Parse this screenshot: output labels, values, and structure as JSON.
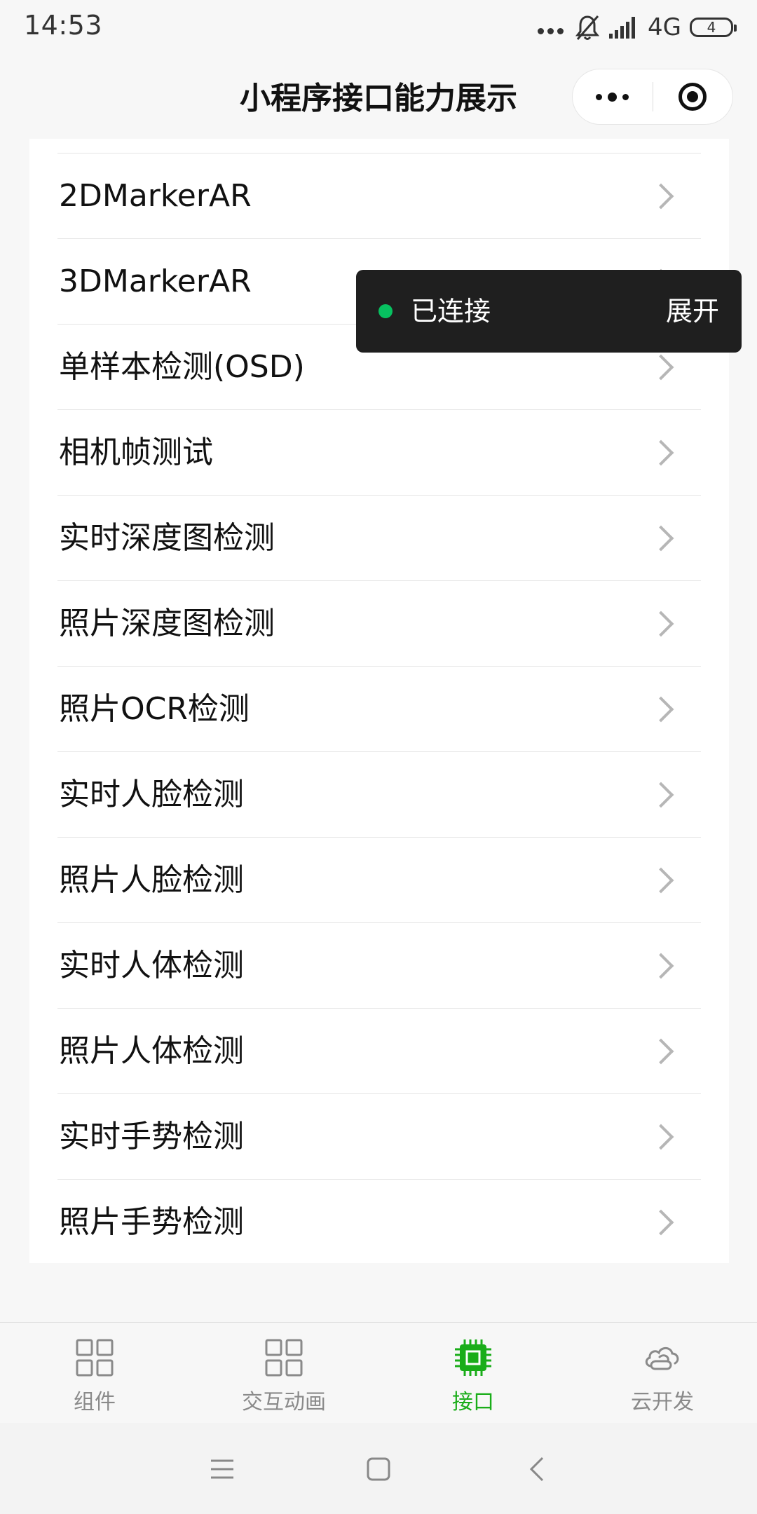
{
  "status_bar": {
    "time": "14:53",
    "network": "4G",
    "battery": "4"
  },
  "header": {
    "title": "小程序接口能力展示"
  },
  "list": {
    "items": [
      {
        "label": "2DMarkerAR"
      },
      {
        "label": "3DMarkerAR"
      },
      {
        "label": "单样本检测(OSD)"
      },
      {
        "label": "相机帧测试"
      },
      {
        "label": "实时深度图检测"
      },
      {
        "label": "照片深度图检测"
      },
      {
        "label": "照片OCR检测"
      },
      {
        "label": "实时人脸检测"
      },
      {
        "label": "照片人脸检测"
      },
      {
        "label": "实时人体检测"
      },
      {
        "label": "照片人体检测"
      },
      {
        "label": "实时手势检测"
      },
      {
        "label": "照片手势检测"
      }
    ]
  },
  "toast": {
    "status": "已连接",
    "action": "展开",
    "dot_color": "#07c160"
  },
  "tab_bar": {
    "active_color": "#1aad19",
    "inactive_color": "#8a8a8a",
    "tabs": [
      {
        "label": "组件",
        "icon": "grid-icon",
        "active": false
      },
      {
        "label": "交互动画",
        "icon": "grid-icon",
        "active": false
      },
      {
        "label": "接口",
        "icon": "chip-icon",
        "active": true
      },
      {
        "label": "云开发",
        "icon": "cloud-icon",
        "active": false
      }
    ]
  }
}
